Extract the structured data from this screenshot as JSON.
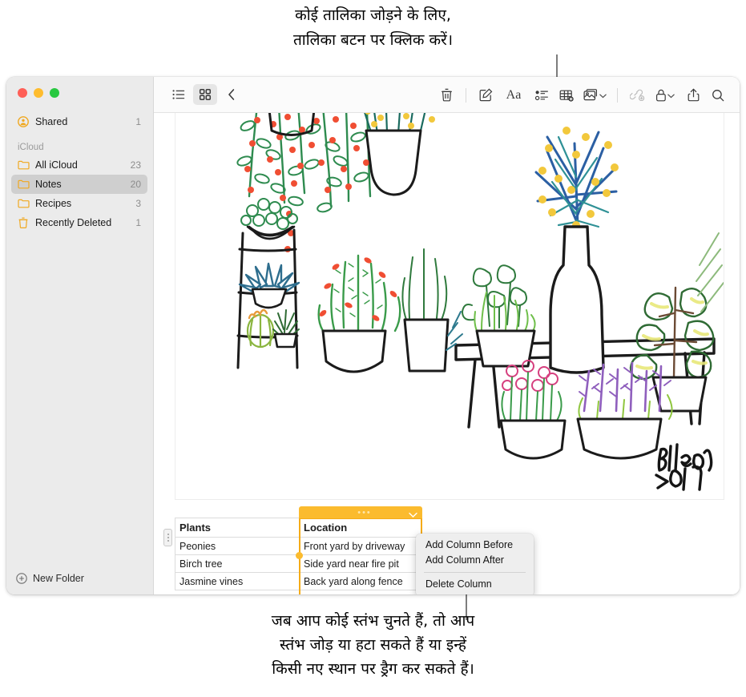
{
  "annotations": {
    "top_callout": "कोई तालिका जोड़ने के लिए,\nतालिका बटन पर क्लिक करें।",
    "bottom_callout": "जब आप कोई स्तंभ चुनते हैं, तो आप\nस्तंभ जोड़ या हटा सकते हैं या इन्हें\nकिसी नए स्थान पर ड्रैग कर सकते हैं।"
  },
  "window": {
    "traffic_lights": [
      "close",
      "minimize",
      "zoom"
    ]
  },
  "sidebar": {
    "shared": {
      "label": "Shared",
      "count": "1",
      "icon": "shared-person-icon"
    },
    "section_header": "iCloud",
    "items": [
      {
        "label": "All iCloud",
        "count": "23",
        "icon": "folder-icon",
        "selected": false
      },
      {
        "label": "Notes",
        "count": "20",
        "icon": "folder-icon",
        "selected": true
      },
      {
        "label": "Recipes",
        "count": "3",
        "icon": "folder-icon",
        "selected": false
      },
      {
        "label": "Recently Deleted",
        "count": "1",
        "icon": "trash-icon",
        "selected": false
      }
    ],
    "new_folder_label": "New Folder"
  },
  "toolbar": {
    "left": [
      {
        "name": "list-view-icon",
        "label": "List View",
        "active": false
      },
      {
        "name": "gallery-view-icon",
        "label": "Gallery View",
        "active": true
      },
      {
        "name": "back-chevron-icon",
        "label": "Back",
        "active": false
      }
    ],
    "right": [
      {
        "name": "trash-icon",
        "label": "Delete"
      },
      {
        "name": "compose-icon",
        "label": "New Note"
      },
      {
        "name": "format-aa-icon",
        "label": "Aa"
      },
      {
        "name": "checklist-icon",
        "label": "Checklist"
      },
      {
        "name": "table-icon",
        "label": "Table"
      },
      {
        "name": "media-icon",
        "label": "Media"
      },
      {
        "name": "link-add-icon",
        "label": "Add Link",
        "dimmed": true
      },
      {
        "name": "lock-icon",
        "label": "Lock Note"
      },
      {
        "name": "share-icon",
        "label": "Share"
      },
      {
        "name": "search-icon",
        "label": "Search"
      }
    ]
  },
  "note": {
    "artwork": {
      "name": "hand-drawn-plants-illustration",
      "signature": "Bella",
      "signature_year": "2019"
    },
    "table": {
      "headers": [
        "Plants",
        "Location"
      ],
      "rows": [
        [
          "Peonies",
          "Front yard by driveway"
        ],
        [
          "Birch tree",
          "Side yard near fire pit"
        ],
        [
          "Jasmine vines",
          "Back yard along fence"
        ]
      ],
      "selected_column_index": 1,
      "selection_color": "#fbbb2e"
    }
  },
  "context_menu": {
    "items": [
      {
        "label": "Add Column Before",
        "divider_after": false
      },
      {
        "label": "Add Column After",
        "divider_after": true
      },
      {
        "label": "Delete Column",
        "divider_after": false
      }
    ]
  }
}
